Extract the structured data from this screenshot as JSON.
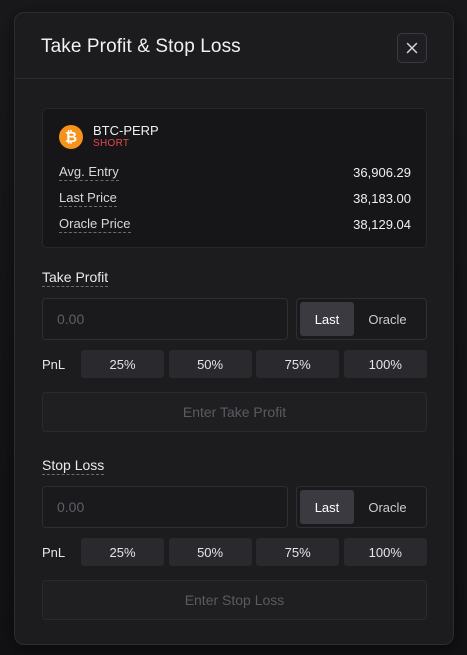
{
  "modal": {
    "title": "Take Profit & Stop Loss",
    "close_icon": "close-icon"
  },
  "market": {
    "icon": "bitcoin-icon",
    "icon_glyph": "₿",
    "icon_color": "#f7931a",
    "name": "BTC-PERP",
    "side": "SHORT",
    "side_color": "#e5484d",
    "rows": [
      {
        "label": "Avg. Entry",
        "value": "36,906.29"
      },
      {
        "label": "Last Price",
        "value": "38,183.00"
      },
      {
        "label": "Oracle Price",
        "value": "38,129.04"
      }
    ]
  },
  "take_profit": {
    "label": "Take Profit",
    "input_value": "",
    "input_placeholder": "0.00",
    "price_source": {
      "options": [
        "Last",
        "Oracle"
      ],
      "selected": "Last"
    },
    "pnl_label": "PnL",
    "pnl_presets": [
      "25%",
      "50%",
      "75%",
      "100%"
    ],
    "submit_label": "Enter Take Profit"
  },
  "stop_loss": {
    "label": "Stop Loss",
    "input_value": "",
    "input_placeholder": "0.00",
    "price_source": {
      "options": [
        "Last",
        "Oracle"
      ],
      "selected": "Last"
    },
    "pnl_label": "PnL",
    "pnl_presets": [
      "25%",
      "50%",
      "75%",
      "100%"
    ],
    "submit_label": "Enter Stop Loss"
  }
}
